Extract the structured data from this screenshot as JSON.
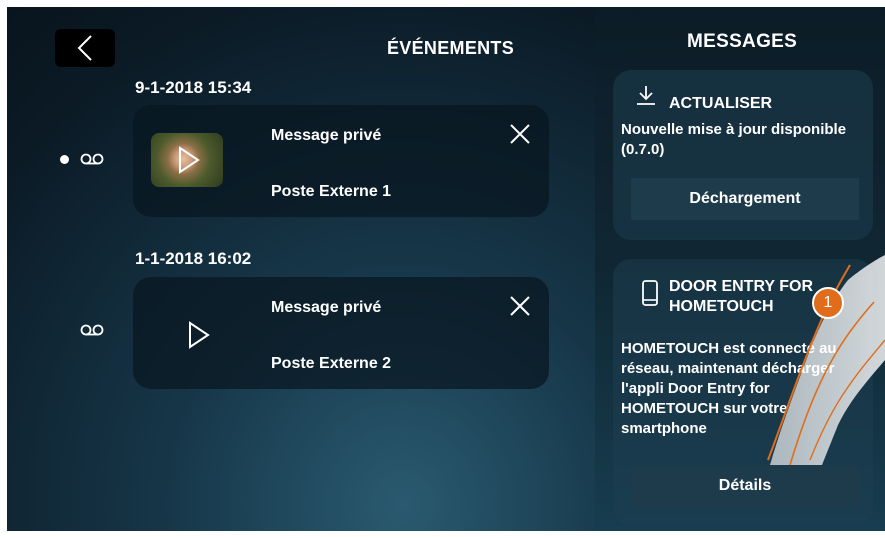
{
  "header": {
    "events_title": "ÉVÉNEMENTS",
    "messages_title": "MESSAGES"
  },
  "events": [
    {
      "date": "9-1-2018  15:34",
      "title": "Message privé",
      "source": "Poste Externe 1",
      "unread": true,
      "has_thumbnail": true
    },
    {
      "date": "1-1-2018  16:02",
      "title": "Message privé",
      "source": "Poste Externe 2",
      "unread": false,
      "has_thumbnail": false
    }
  ],
  "messages": [
    {
      "icon": "download-icon",
      "title": "ACTUALISER",
      "body": "Nouvelle mise à jour disponible (0.7.0)",
      "button": "Déchargement"
    },
    {
      "icon": "smartphone-icon",
      "title": "DOOR ENTRY FOR HOMETOUCH",
      "body": "HOMETOUCH est connecté au réseau, maintenant décharger l'appli Door Entry for HOMETOUCH sur votre smartphone",
      "button": "Détails"
    }
  ],
  "callout": {
    "number": "1"
  },
  "colors": {
    "accent": "#e06d1b",
    "panel": "#1e3b4c"
  }
}
